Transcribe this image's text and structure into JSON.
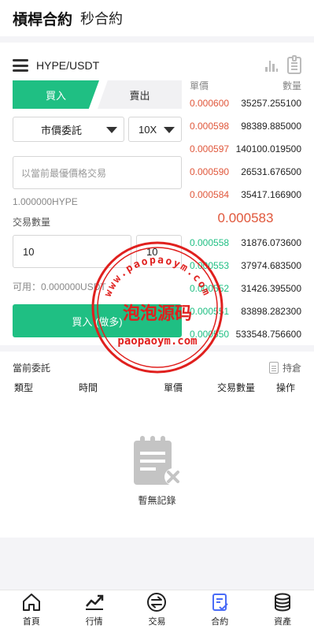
{
  "header": {
    "title": "槓桿合約",
    "subtitle": "秒合約"
  },
  "pair": {
    "name": "HYPE/USDT"
  },
  "trade": {
    "tab_buy": "買入",
    "tab_sell": "賣出",
    "order_type": "市價委託",
    "leverage": "10X",
    "price_placeholder": "以當前最優價格交易",
    "hint": "1.000000HYPE",
    "qty_label": "交易數量",
    "qty_value": "10",
    "lev_value": "10",
    "available": "可用：0.000000USDT",
    "buy_button": "買入 (做多)"
  },
  "book": {
    "price_header": "單價",
    "qty_header": "數量",
    "asks": [
      {
        "price": "0.000600",
        "qty": "35257.255100"
      },
      {
        "price": "0.000598",
        "qty": "98389.885000"
      },
      {
        "price": "0.000597",
        "qty": "140100.019500"
      },
      {
        "price": "0.000590",
        "qty": "26531.676500"
      },
      {
        "price": "0.000584",
        "qty": "35417.166900"
      }
    ],
    "mid": "0.000583",
    "bids": [
      {
        "price": "0.000558",
        "qty": "31876.073600"
      },
      {
        "price": "0.000553",
        "qty": "37974.683500"
      },
      {
        "price": "0.000552",
        "qty": "31426.395500"
      },
      {
        "price": "0.000551",
        "qty": "83898.282300"
      },
      {
        "price": "0.000550",
        "qty": "533548.756600"
      }
    ]
  },
  "orders": {
    "title": "當前委託",
    "hold_label": "持倉",
    "columns": [
      "類型",
      "時間",
      "單價",
      "交易數量",
      "操作"
    ],
    "empty": "暫無記錄"
  },
  "watermark": {
    "url": "www.paopaoym.com",
    "name": "泡泡源码",
    "domain": "paopaoym.com"
  },
  "nav": [
    {
      "label": "首頁",
      "icon": "home-icon"
    },
    {
      "label": "行情",
      "icon": "trend-icon"
    },
    {
      "label": "交易",
      "icon": "exchange-icon"
    },
    {
      "label": "合約",
      "icon": "contract-icon"
    },
    {
      "label": "資產",
      "icon": "assets-icon"
    }
  ],
  "colors": {
    "accent": "#1fbf83",
    "ask": "#e0573b",
    "nav_active": "#4a6cf7",
    "stamp": "#e0201e"
  }
}
